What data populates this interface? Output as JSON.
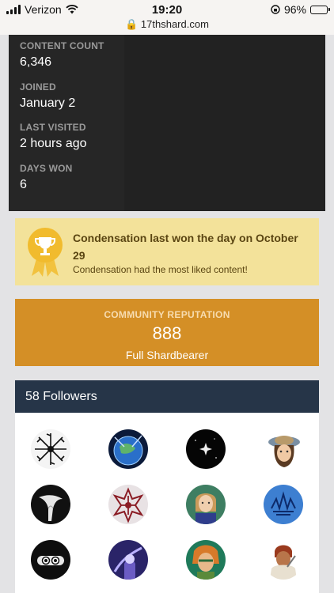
{
  "status_bar": {
    "carrier": "Verizon",
    "time": "19:20",
    "url": "17thshard.com",
    "battery": "96%"
  },
  "stats": [
    {
      "label": "CONTENT COUNT",
      "value": "6,346"
    },
    {
      "label": "JOINED",
      "value": "January 2"
    },
    {
      "label": "LAST VISITED",
      "value": "2 hours ago"
    },
    {
      "label": "DAYS WON",
      "value": "6"
    }
  ],
  "award": {
    "title": "Condensation last won the day on October 29",
    "description": "Condensation had the most liked content!"
  },
  "reputation": {
    "label": "COMMUNITY REPUTATION",
    "value": "888",
    "rank": "Full Shardbearer"
  },
  "followers": {
    "header": "58 Followers",
    "avatars": [
      "avatar-black-tree",
      "avatar-blue-planet",
      "avatar-star-black",
      "avatar-girl-hat",
      "avatar-white-figure",
      "avatar-red-emblem",
      "avatar-blonde-girl",
      "avatar-blue-glyph",
      "avatar-ninja",
      "avatar-purple-mage",
      "avatar-green-fairy",
      "avatar-red-warrior"
    ]
  }
}
